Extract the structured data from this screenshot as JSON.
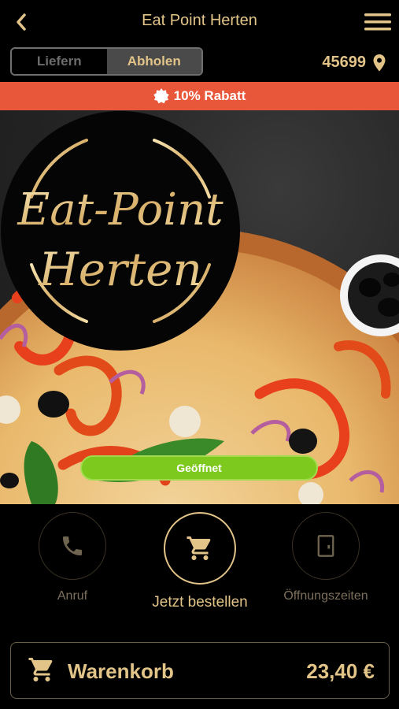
{
  "header": {
    "title": "Eat Point Herten",
    "back_icon": "chevron-left-icon",
    "menu_icon": "hamburger-menu-icon"
  },
  "delivery_toggle": {
    "options": [
      "Liefern",
      "Abholen"
    ],
    "selected": "Abholen"
  },
  "location": {
    "postal_code": "45699",
    "icon": "location-pin-icon"
  },
  "discount_banner": {
    "icon": "badge-icon",
    "text": "10% Rabatt",
    "color": "#e9573a"
  },
  "hero": {
    "logo_line1": "Eat-Point",
    "logo_line2": "Herten",
    "status_label": "Geöffnet",
    "status_color": "#7ec91d"
  },
  "actions": [
    {
      "label": "Anruf",
      "icon": "phone-icon"
    },
    {
      "label": "Jetzt bestellen",
      "icon": "shopping-cart-icon"
    },
    {
      "label": "Öffnungszeiten",
      "icon": "door-icon"
    }
  ],
  "cart": {
    "label": "Warenkorb",
    "total": "23,40 €",
    "icon": "shopping-cart-icon"
  },
  "colors": {
    "accent_gold": "#e2c489",
    "background": "#000000"
  }
}
